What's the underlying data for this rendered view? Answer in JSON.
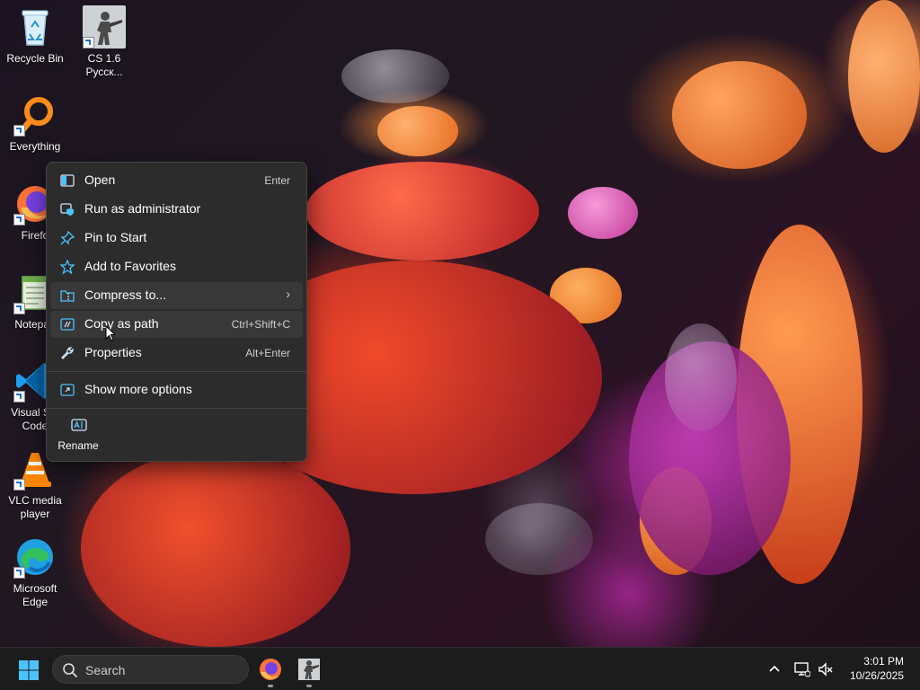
{
  "desktop": {
    "icons": [
      {
        "label": "Recycle Bin",
        "icon": "recycle-bin-icon"
      },
      {
        "label": "CS 1.6\nРусск...",
        "icon": "counter-strike-icon"
      },
      {
        "label": "Everything",
        "icon": "everything-search-icon"
      },
      {
        "label": "Firefo",
        "icon": "firefox-icon"
      },
      {
        "label": "Notepad",
        "icon": "notepad-icon"
      },
      {
        "label": "Visual Stu\nCode",
        "icon": "vscode-icon"
      },
      {
        "label": "VLC media\nplayer",
        "icon": "vlc-icon"
      },
      {
        "label": "Microsoft\nEdge",
        "icon": "edge-icon"
      }
    ]
  },
  "context_menu": {
    "items": [
      {
        "label": "Open",
        "shortcut": "Enter",
        "icon": "open-icon"
      },
      {
        "label": "Run as administrator",
        "shortcut": "",
        "icon": "shield-icon"
      },
      {
        "label": "Pin to Start",
        "shortcut": "",
        "icon": "pin-icon"
      },
      {
        "label": "Add to Favorites",
        "shortcut": "",
        "icon": "star-icon"
      },
      {
        "label": "Compress to...",
        "shortcut": "",
        "icon": "zip-folder-icon",
        "has_submenu": true
      },
      {
        "label": "Copy as path",
        "shortcut": "Ctrl+Shift+C",
        "icon": "copy-path-icon"
      },
      {
        "label": "Properties",
        "shortcut": "Alt+Enter",
        "icon": "wrench-icon"
      },
      {
        "label": "Show more options",
        "shortcut": "",
        "icon": "share-icon"
      }
    ],
    "rename_label": "Rename",
    "submenu_chevron": "›"
  },
  "taskbar": {
    "search_placeholder": "Search",
    "pinned": [
      "firefox-icon",
      "counter-strike-icon"
    ],
    "clock": {
      "time": "3:01 PM",
      "date": "10/26/2025"
    }
  },
  "colors": {
    "menu_bg": "#2c2c2c",
    "accent": "#4cc2ff",
    "taskbar_bg": "#1c1c1c"
  }
}
